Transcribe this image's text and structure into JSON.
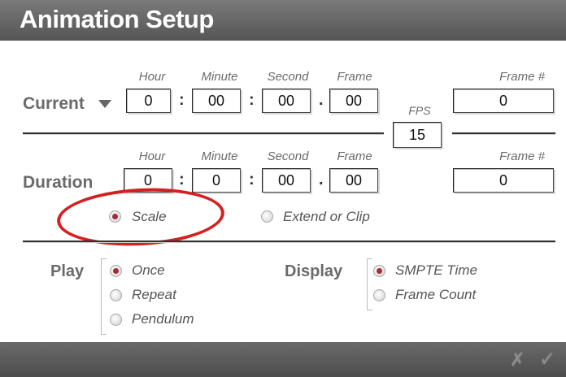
{
  "window": {
    "title": "Animation Setup"
  },
  "current": {
    "label": "Current",
    "hour_h": "Hour",
    "minute_h": "Minute",
    "second_h": "Second",
    "frame_h": "Frame",
    "framenum_h": "Frame #",
    "hour": "0",
    "minute": "00",
    "second": "00",
    "frame": "00",
    "framenum": "0"
  },
  "fps": {
    "label": "FPS",
    "value": "15"
  },
  "duration": {
    "label": "Duration",
    "hour_h": "Hour",
    "minute_h": "Minute",
    "second_h": "Second",
    "frame_h": "Frame",
    "framenum_h": "Frame #",
    "hour": "0",
    "minute": "0",
    "second": "00",
    "frame": "00",
    "framenum": "0"
  },
  "separators": {
    "colon": ":",
    "dot": "."
  },
  "mode": {
    "scale": "Scale",
    "extend": "Extend or Clip",
    "selected": "scale"
  },
  "play": {
    "label": "Play",
    "options": [
      "Once",
      "Repeat",
      "Pendulum"
    ],
    "selected": "Once"
  },
  "display": {
    "label": "Display",
    "options": [
      "SMPTE Time",
      "Frame Count"
    ],
    "selected": "SMPTE Time"
  },
  "footer": {
    "cancel": "✗",
    "ok": "✓"
  },
  "colors": {
    "accent": "#a52a3a",
    "annotation": "#d42020",
    "bar": "#5a5a5a"
  }
}
